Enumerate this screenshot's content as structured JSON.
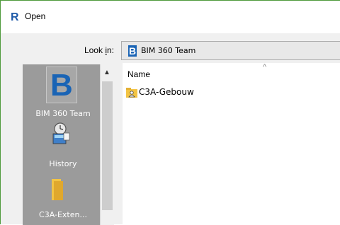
{
  "window": {
    "title": "Open"
  },
  "lookin": {
    "label": "Look in:",
    "value": "BIM 360 Team"
  },
  "places": [
    {
      "label": "BIM 360 Team",
      "icon": "bim360-icon"
    },
    {
      "label": "History",
      "icon": "history-icon"
    },
    {
      "label": "C3A-Exten...",
      "icon": "folder-icon"
    }
  ],
  "filelist": {
    "column_name": "Name",
    "items": [
      {
        "name": "C3A-Gebouw",
        "icon": "shared-folder-icon"
      }
    ]
  },
  "colors": {
    "bim_blue": "#1a64b5",
    "revit_blue": "#1e5aa8",
    "folder_yellow": "#f3c443",
    "window_border": "#4f9a3c"
  }
}
